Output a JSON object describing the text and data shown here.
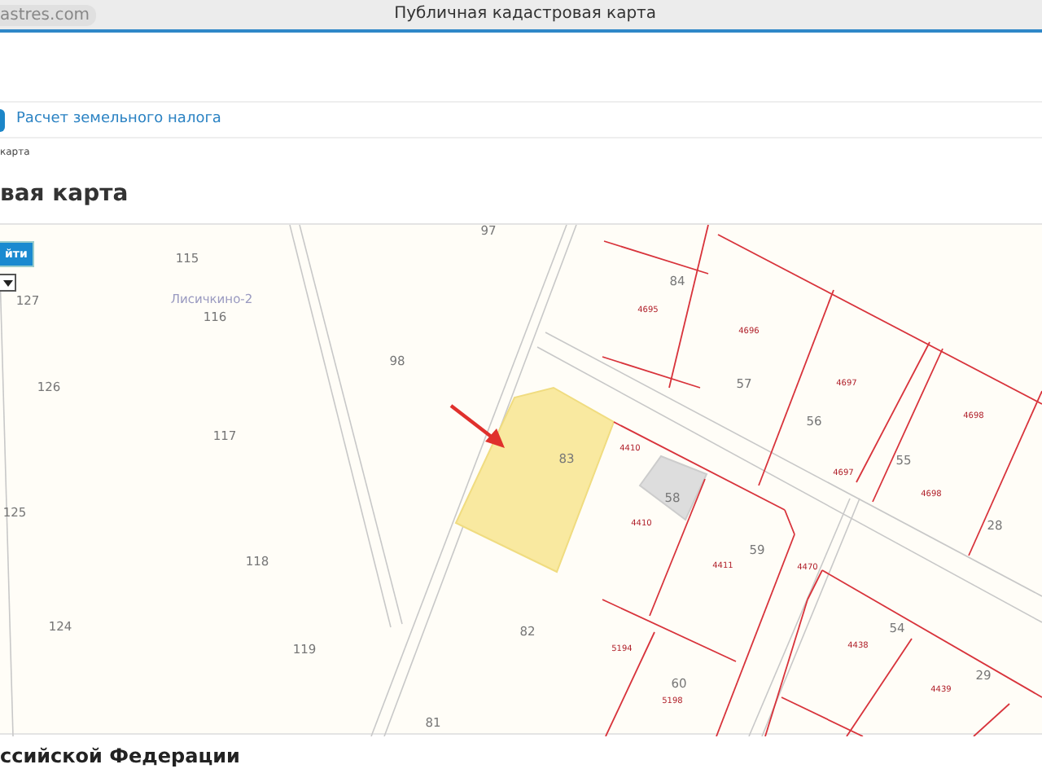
{
  "browser": {
    "address": "astres.com",
    "title": "Публичная кадастровая карта"
  },
  "nav": {
    "link": "Расчет земельного налога"
  },
  "breadcrumb": "карта",
  "heading": "вая карта",
  "map": {
    "search_button": "йти",
    "labels": [
      {
        "kind": "parcel",
        "text": "97"
      },
      {
        "kind": "parcel",
        "text": "115"
      },
      {
        "kind": "parcel",
        "text": "127"
      },
      {
        "kind": "place",
        "text": "Лисичкино-2"
      },
      {
        "kind": "parcel",
        "text": "116"
      },
      {
        "kind": "parcel",
        "text": "126"
      },
      {
        "kind": "parcel",
        "text": "98"
      },
      {
        "kind": "parcel",
        "text": "117"
      },
      {
        "kind": "parcel",
        "text": "125"
      },
      {
        "kind": "parcel",
        "text": "118"
      },
      {
        "kind": "parcel",
        "text": "124"
      },
      {
        "kind": "parcel",
        "text": "119"
      },
      {
        "kind": "parcel",
        "text": "82"
      },
      {
        "kind": "parcel",
        "text": "81"
      },
      {
        "kind": "parcel",
        "text": "83"
      },
      {
        "kind": "parcel",
        "text": "84"
      },
      {
        "kind": "number",
        "text": "4695"
      },
      {
        "kind": "number",
        "text": "4696"
      },
      {
        "kind": "parcel",
        "text": "57"
      },
      {
        "kind": "number",
        "text": "4697"
      },
      {
        "kind": "parcel",
        "text": "56"
      },
      {
        "kind": "number",
        "text": "4697"
      },
      {
        "kind": "parcel",
        "text": "55"
      },
      {
        "kind": "number",
        "text": "4698"
      },
      {
        "kind": "number",
        "text": "4698"
      },
      {
        "kind": "parcel",
        "text": "28"
      },
      {
        "kind": "number",
        "text": "4410"
      },
      {
        "kind": "parcel",
        "text": "58"
      },
      {
        "kind": "number",
        "text": "4410"
      },
      {
        "kind": "number",
        "text": "4411"
      },
      {
        "kind": "parcel",
        "text": "59"
      },
      {
        "kind": "number",
        "text": "4470"
      },
      {
        "kind": "number",
        "text": "5194"
      },
      {
        "kind": "parcel",
        "text": "60"
      },
      {
        "kind": "number",
        "text": "5198"
      },
      {
        "kind": "parcel",
        "text": "54"
      },
      {
        "kind": "number",
        "text": "4438"
      },
      {
        "kind": "parcel",
        "text": "29"
      },
      {
        "kind": "number",
        "text": "4439"
      }
    ]
  },
  "footer_heading": "ссийской Федерации"
}
